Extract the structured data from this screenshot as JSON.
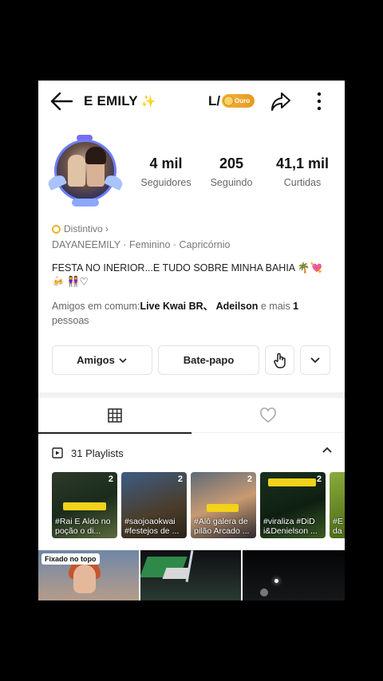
{
  "header": {
    "name": "E EMILY",
    "sparkle": "✨",
    "level_prefix": "L/",
    "level_badge": "Ouro",
    "accent": "#e89a1f"
  },
  "profile": {
    "stats": [
      {
        "value": "4 mil",
        "label": "Seguidores"
      },
      {
        "value": "205",
        "label": "Seguindo"
      },
      {
        "value": "41,1 mil",
        "label": "Curtidas"
      }
    ],
    "distintivo": "Distintivo ›",
    "meta": "DAYANEEMILY · Feminino · Capricórnio",
    "bio": "FESTA NO INERIOR...E TUDO SOBRE MINHA BAHIA 🌴💘🍻 👭♡",
    "friends_prefix": "Amigos em comum:",
    "friends_names": "Live Kwai BR、 Adeilson",
    "friends_mid": " e mais ",
    "friends_count": "1",
    "friends_suffix": " pessoas"
  },
  "actions": {
    "amigos": "Amigos",
    "chat": "Bate-papo"
  },
  "tabs": {
    "grid_icon": "grid-icon",
    "likes_icon": "heart-icon"
  },
  "playlists": {
    "title": "31 Playlists",
    "items": [
      {
        "count": "2",
        "caption": "#Rai E Aldo no poção o di..."
      },
      {
        "count": "2",
        "caption": "#saojoaokwai #festejos de ..."
      },
      {
        "count": "2",
        "caption": "#Alô galera de pilão Arcado ..."
      },
      {
        "count": "2",
        "caption": "#viraliza #DiD i&Denielson ..."
      },
      {
        "count": "",
        "caption": "#E da"
      }
    ]
  },
  "grid": {
    "pinned_label": "Fixado no topo"
  }
}
